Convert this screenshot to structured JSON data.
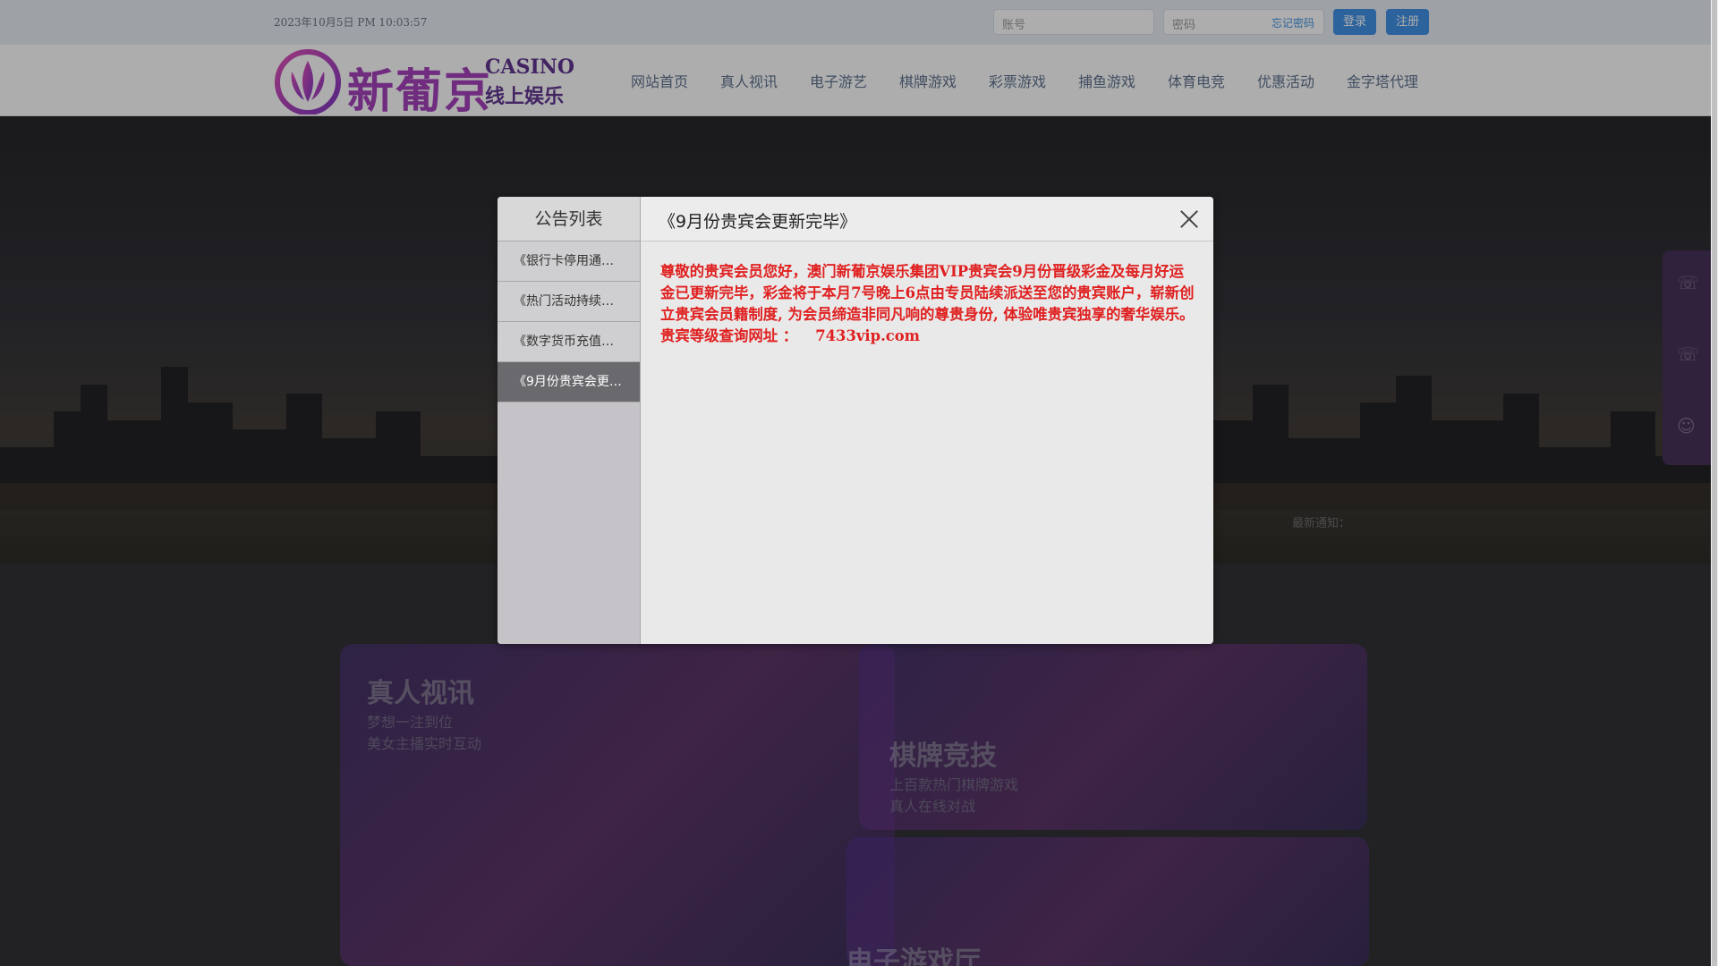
{
  "topbar": {
    "datetime": "2023年10月5日 PM 10:03:57",
    "account_placeholder": "账号",
    "password_placeholder": "密码",
    "forgot_label": "忘记密码",
    "login_label": "登录",
    "register_label": "注册"
  },
  "header": {
    "logo_main": "新葡京",
    "logo_casino": "CASINO",
    "logo_sub": "线上娱乐",
    "nav": [
      "网站首页",
      "真人视讯",
      "电子游艺",
      "棋牌游戏",
      "彩票游戏",
      "捕鱼游戏",
      "体育电竞",
      "优惠活动",
      "金字塔代理"
    ]
  },
  "hero": {
    "notice_label": "最新通知："
  },
  "promos": {
    "live_title": "真人视讯",
    "live_line1": "梦想一注到位",
    "live_line2": "美女主播实时互动",
    "chess_title": "棋牌竞技",
    "chess_line1": "上百款热门棋牌游戏",
    "chess_line2": "真人在线对战",
    "slots_title": "电子游戏厅"
  },
  "modal": {
    "side_title": "公告列表",
    "items": [
      "《银行卡停用通…",
      "《热门活动持续…",
      "《数字货币充值…",
      "《9月份贵宾会更…"
    ],
    "active_index": 3,
    "title": "《9月份贵宾会更新完毕》",
    "body": "尊敬的贵宾会员您好，澳门新葡京娱乐集团VIP贵宾会9月份晋级彩金及每月好运金已更新完毕，彩金将于本月7号晚上6点由专员陆续派送至您的贵宾账户，崭新创立贵宾会员籍制度, 为会员缔造非同凡响的尊贵身份, 体验唯贵宾独享的奢华娱乐。贵宾等级查询网址 ：",
    "url": "7433vip.com"
  },
  "colors": {
    "accent": "#3a8ee6",
    "alert_text": "#e02020",
    "active_item": "#6a6a6e"
  }
}
